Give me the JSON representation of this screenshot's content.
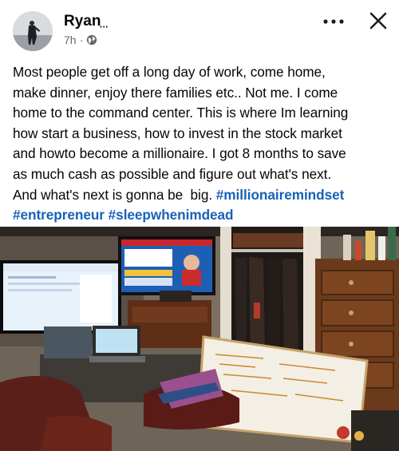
{
  "post": {
    "author": "Ryan",
    "author_suffix": "̦ ̦ ̦",
    "time": "7h",
    "separator": "·",
    "privacy_icon": "globe-icon",
    "lines": [
      "Most people get off a long day of work, come home,",
      "make dinner, enjoy there families etc.. Not me. I come",
      "home to the command center. This is where Im learning",
      "how start a business, how to invest in the stock market",
      "and howto become a millionaire. I got 8 months to save",
      "as much cash as possible and figure out what's next."
    ],
    "line7_text": "And what's next is gonna be  big. ",
    "hashtags": [
      "#millionairemindset",
      "#entrepreneur",
      "#sleepwhenimdead"
    ]
  },
  "icons": {
    "more": "more-horizontal-icon",
    "close": "close-icon"
  },
  "colors": {
    "hashtag": "#1861b8",
    "meta": "#65676b",
    "text": "#050505"
  }
}
